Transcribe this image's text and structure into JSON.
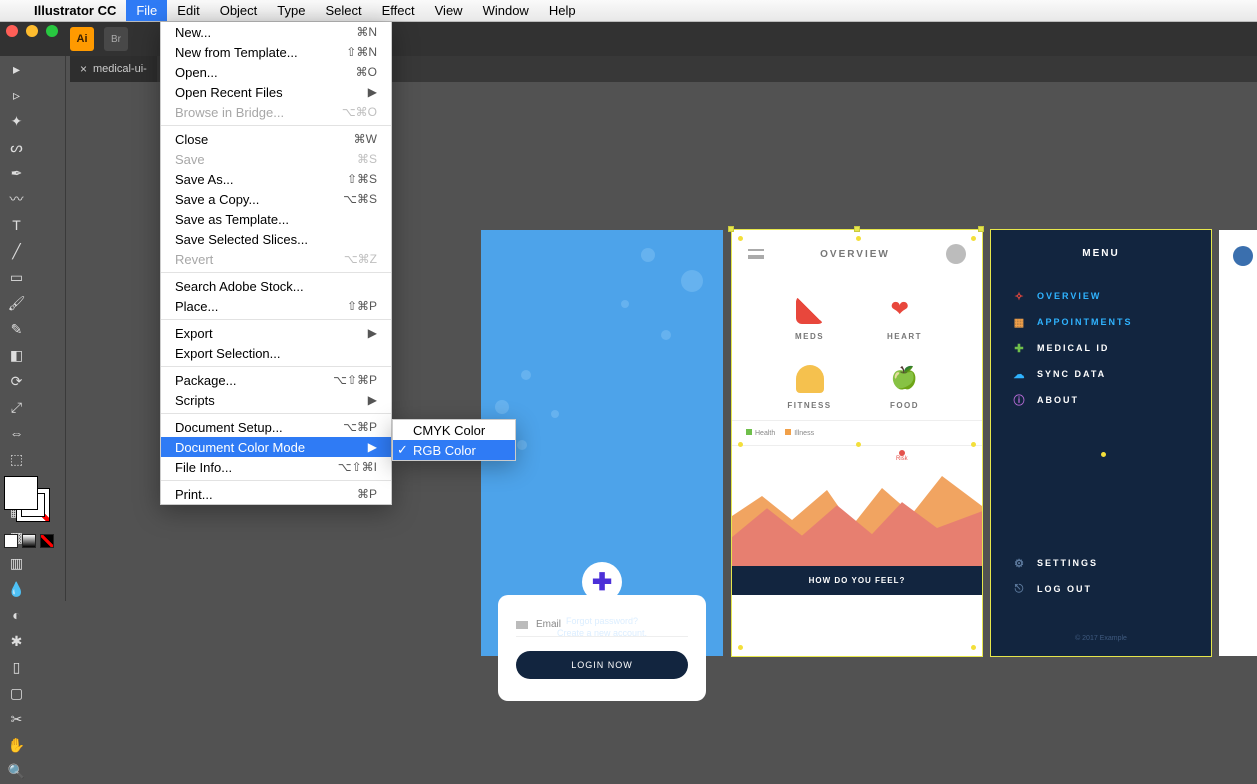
{
  "app": {
    "name": "Illustrator CC"
  },
  "menubar": {
    "items": [
      "File",
      "Edit",
      "Object",
      "Type",
      "Select",
      "Effect",
      "View",
      "Window",
      "Help"
    ],
    "selected": "File"
  },
  "tab": {
    "label": "medical-ui-"
  },
  "file_menu": {
    "new": "New...",
    "new_sc": "⌘N",
    "new_template": "New from Template...",
    "new_template_sc": "⇧⌘N",
    "open": "Open...",
    "open_sc": "⌘O",
    "open_recent": "Open Recent Files",
    "browse": "Browse in Bridge...",
    "browse_sc": "⌥⌘O",
    "close": "Close",
    "close_sc": "⌘W",
    "save": "Save",
    "save_sc": "⌘S",
    "saveas": "Save As...",
    "saveas_sc": "⇧⌘S",
    "savecopy": "Save a Copy...",
    "savecopy_sc": "⌥⌘S",
    "savetemplate": "Save as Template...",
    "saveslices": "Save Selected Slices...",
    "revert": "Revert",
    "revert_sc": "⌥⌘Z",
    "search": "Search Adobe Stock...",
    "place": "Place...",
    "place_sc": "⇧⌘P",
    "export": "Export",
    "exportsel": "Export Selection...",
    "package": "Package...",
    "package_sc": "⌥⇧⌘P",
    "scripts": "Scripts",
    "docsetup": "Document Setup...",
    "docsetup_sc": "⌥⌘P",
    "colormode": "Document Color Mode",
    "fileinfo": "File Info...",
    "fileinfo_sc": "⌥⇧⌘I",
    "print": "Print...",
    "print_sc": "⌘P"
  },
  "submenu": {
    "cmyk": "CMYK Color",
    "rgb": "RGB Color"
  },
  "login": {
    "email_label": "Email",
    "button": "LOGIN NOW",
    "forgot": "Forgot password?",
    "create": "Create a new account."
  },
  "overview": {
    "title": "OVERVIEW",
    "meds": "MEDS",
    "heart": "HEART",
    "fitness": "FITNESS",
    "food": "FOOD",
    "health": "Health",
    "illness": "Illness",
    "risk": "Risk",
    "footer": "HOW DO YOU FEEL?"
  },
  "menu_screen": {
    "title": "MENU",
    "overview": "OVERVIEW",
    "appts": "APPOINTMENTS",
    "medid": "MEDICAL ID",
    "sync": "SYNC DATA",
    "about": "ABOUT",
    "settings": "SETTINGS",
    "logout": "LOG OUT",
    "copyright": "© 2017 Example"
  }
}
